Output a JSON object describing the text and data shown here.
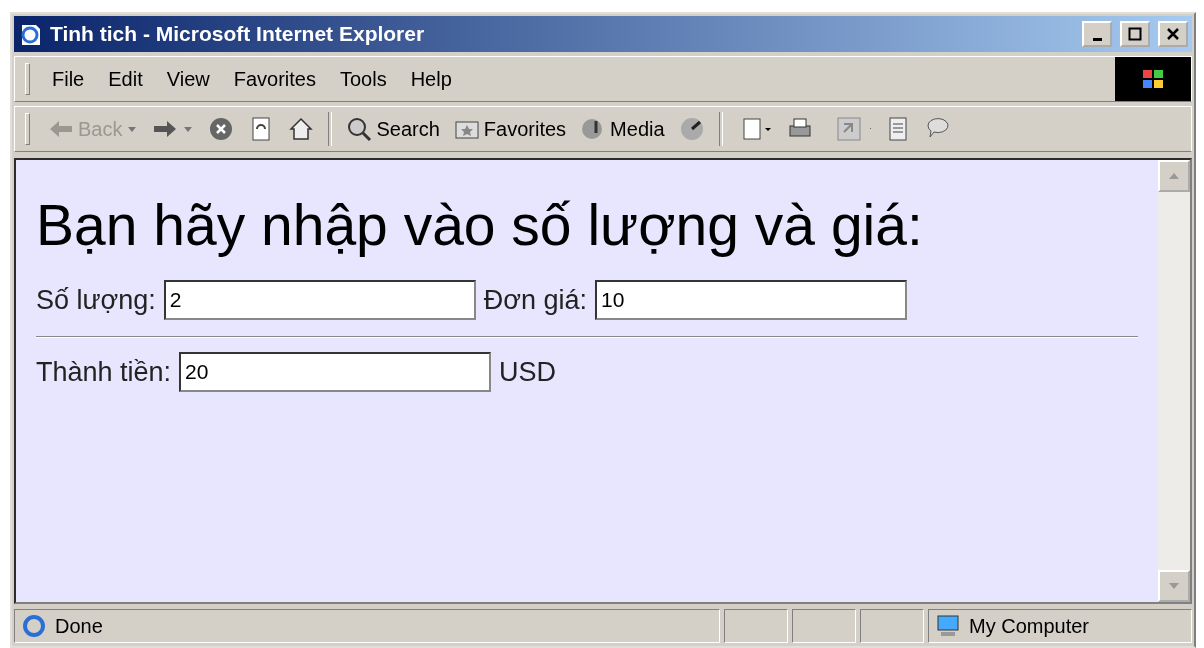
{
  "window": {
    "title": "Tinh tich - Microsoft Internet Explorer"
  },
  "menu": [
    "File",
    "Edit",
    "View",
    "Favorites",
    "Tools",
    "Help"
  ],
  "toolbar": [
    {
      "kind": "back",
      "label": "Back",
      "disabled": true
    },
    {
      "kind": "forward"
    },
    {
      "kind": "stop"
    },
    {
      "kind": "refresh"
    },
    {
      "kind": "home"
    },
    {
      "kind": "separator"
    },
    {
      "kind": "search",
      "label": "Search"
    },
    {
      "kind": "favorites",
      "label": "Favorites"
    },
    {
      "kind": "media",
      "label": "Media"
    },
    {
      "kind": "history"
    },
    {
      "kind": "separator"
    },
    {
      "kind": "mail"
    },
    {
      "kind": "print"
    },
    {
      "kind": "edit"
    },
    {
      "kind": "discuss"
    },
    {
      "kind": "messenger"
    }
  ],
  "page": {
    "heading": "Bạn hãy nhập vào số lượng và giá:",
    "row1": [
      {
        "label": "Số lượng:",
        "value": "2"
      },
      {
        "label": "Đơn giá:",
        "value": "10"
      }
    ],
    "row2": {
      "label": "Thành tiền:",
      "value": "20",
      "unit": "USD"
    }
  },
  "status_bar": {
    "text": "Done",
    "zone": "My Computer"
  }
}
